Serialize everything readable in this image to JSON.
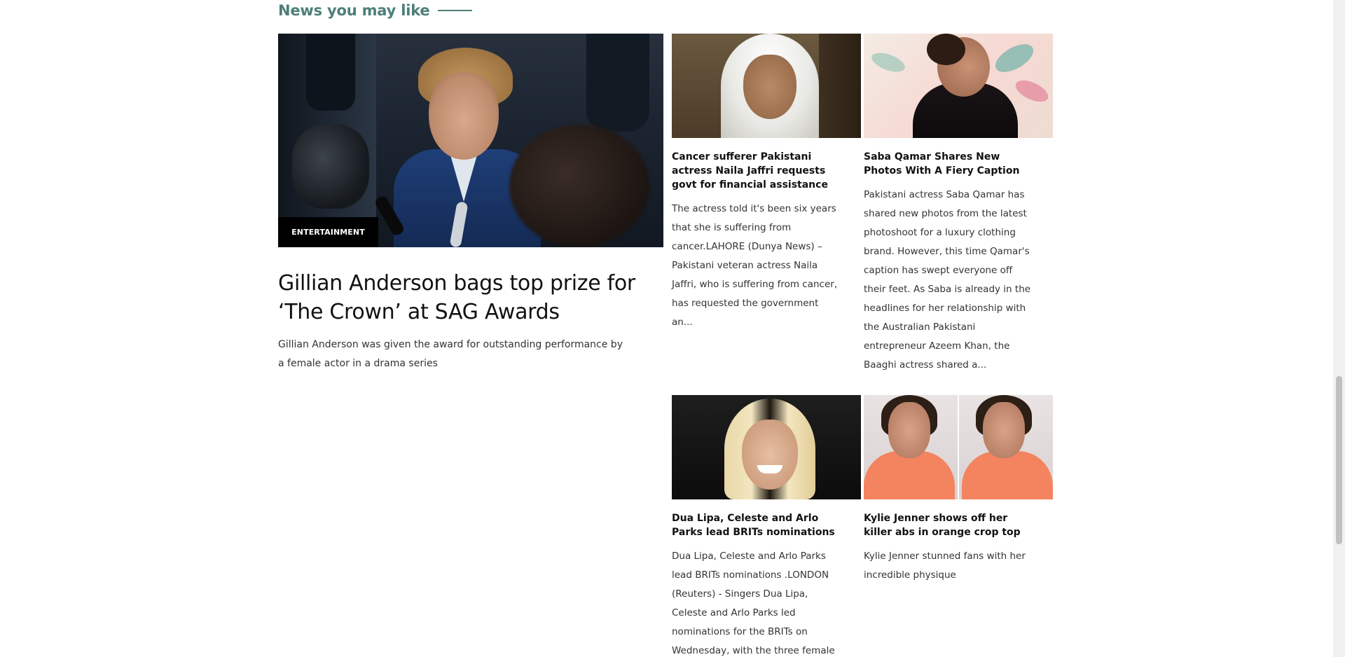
{
  "section": {
    "title": "News you may like"
  },
  "featured": {
    "category": "ENTERTAINMENT",
    "title": "Gillian Anderson bags top prize for ‘The Crown’ at SAG Awards",
    "excerpt": "Gillian Anderson was given the award for outstanding performance by a female actor in a drama series"
  },
  "cards": [
    {
      "title": "Cancer sufferer Pakistani actress Naila Jaffri requests govt for financial assistance",
      "excerpt": "The actress told it's been six years that she is suffering from cancer.LAHORE (Dunya News) – Pakistani veteran actress Naila Jaffri, who is suffering from cancer, has requested the government an..."
    },
    {
      "title": "Saba Qamar Shares New Photos With A Fiery Caption",
      "excerpt": "Pakistani actress Saba Qamar has shared new photos from the latest photoshoot for a luxury clothing brand. However, this time Qamar's caption has swept everyone off their feet. As Saba is already in the headlines for her relationship with the Australian Pakistani entrepreneur Azeem Khan, the Baaghi actress shared a..."
    },
    {
      "title": "Dua Lipa, Celeste and Arlo Parks lead BRITs nominations",
      "excerpt": "Dua Lipa, Celeste and Arlo Parks lead BRITs nominations .LONDON (Reuters) - Singers Dua Lipa, Celeste and Arlo Parks led nominations for the BRITs on Wednesday, with the three female"
    },
    {
      "title": "Kylie Jenner shows off her killer abs in orange crop top",
      "excerpt": "Kylie Jenner stunned fans with her incredible physique"
    }
  ],
  "colors": {
    "section_accent": "#4d7f7a",
    "category_bg": "#000000"
  }
}
